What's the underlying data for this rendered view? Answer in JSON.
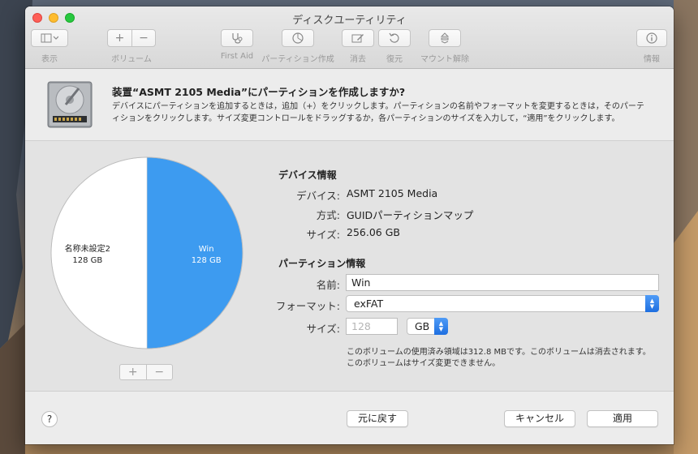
{
  "window": {
    "title": "ディスクユーティリティ"
  },
  "toolbar": {
    "view_label": "表示",
    "volume_label": "ボリューム",
    "volume_add": "+",
    "volume_remove": "−",
    "firstaid_label": "First Aid",
    "partition_label": "パーティション作成",
    "erase_label": "消去",
    "restore_label": "復元",
    "unmount_label": "マウント解除",
    "info_label": "情報"
  },
  "sheet": {
    "title": "装置“ASMT 2105 Media”にパーティションを作成しますか?",
    "desc_line1": "デバイスにパーティションを追加するときは，追加（+）をクリックします。パーティションの名前やフォーマットを変更するときは，そのパーテ",
    "desc_line2": "ィションをクリックします。サイズ変更コントロールをドラッグするか，各パーティションのサイズを入力して，“適用”をクリックします。"
  },
  "pie": {
    "partitions": [
      {
        "name": "名称未設定2",
        "size": "128 GB",
        "value": 128,
        "color": "#ffffff",
        "text_color": "#222222"
      },
      {
        "name": "Win",
        "size": "128 GB",
        "value": 128,
        "color": "#3d9bf0",
        "text_color": "#ffffff"
      }
    ],
    "add": "+",
    "remove": "−"
  },
  "device_info": {
    "title": "デバイス情報",
    "device_label": "デバイス:",
    "device_value": "ASMT 2105 Media",
    "scheme_label": "方式:",
    "scheme_value": "GUIDパーティションマップ",
    "size_label": "サイズ:",
    "size_value": "256.06 GB"
  },
  "partition_info": {
    "title": "パーティション情報",
    "name_label": "名前:",
    "name_value": "Win",
    "format_label": "フォーマット:",
    "format_value": "exFAT",
    "size_label": "サイズ:",
    "size_placeholder": "128",
    "unit_value": "GB",
    "note_line1": "このボリュームの使用済み領域は312.8 MBです。このボリュームは消去されます。",
    "note_line2": "このボリュームはサイズ変更できません。"
  },
  "footer": {
    "help": "?",
    "revert": "元に戻す",
    "cancel": "キャンセル",
    "apply": "適用"
  },
  "colors": {
    "accent": "#3d9bf0"
  }
}
